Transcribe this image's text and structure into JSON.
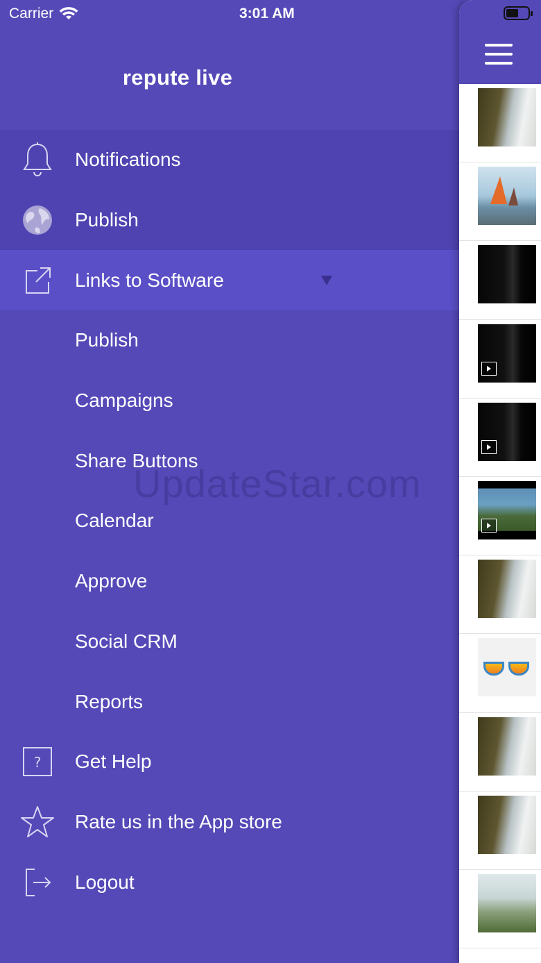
{
  "status_bar": {
    "carrier": "Carrier",
    "time": "3:01 AM"
  },
  "menu": {
    "title": "repute live",
    "items": [
      {
        "label": "Notifications",
        "icon": "bell-icon"
      },
      {
        "label": "Publish",
        "icon": "globe-icon"
      },
      {
        "label": "Links to Software",
        "icon": "external-link-icon",
        "expanded": true
      },
      {
        "label": "Publish"
      },
      {
        "label": "Campaigns"
      },
      {
        "label": "Share Buttons"
      },
      {
        "label": "Calendar"
      },
      {
        "label": "Approve"
      },
      {
        "label": "Social CRM"
      },
      {
        "label": "Reports"
      },
      {
        "label": "Get Help",
        "icon": "help-icon"
      },
      {
        "label": "Rate us in the App store",
        "icon": "star-icon"
      },
      {
        "label": "Logout",
        "icon": "logout-icon"
      }
    ]
  },
  "watermark": "UpdateStar.com",
  "panel": {
    "menu_icon": "hamburger-icon",
    "thumbnails": [
      {
        "kind": "waterfall"
      },
      {
        "kind": "sailboat"
      },
      {
        "kind": "dark"
      },
      {
        "kind": "dark",
        "video": true
      },
      {
        "kind": "dark",
        "video": true
      },
      {
        "kind": "game",
        "video": true
      },
      {
        "kind": "waterfall"
      },
      {
        "kind": "glasses"
      },
      {
        "kind": "waterfall"
      },
      {
        "kind": "waterfall"
      },
      {
        "kind": "grass"
      }
    ]
  },
  "colors": {
    "menu_bg": "#5549b8",
    "selected_bg": "#4e43b1",
    "expanded_bg": "#5a4fc6",
    "panel_bg": "#ffffff"
  }
}
